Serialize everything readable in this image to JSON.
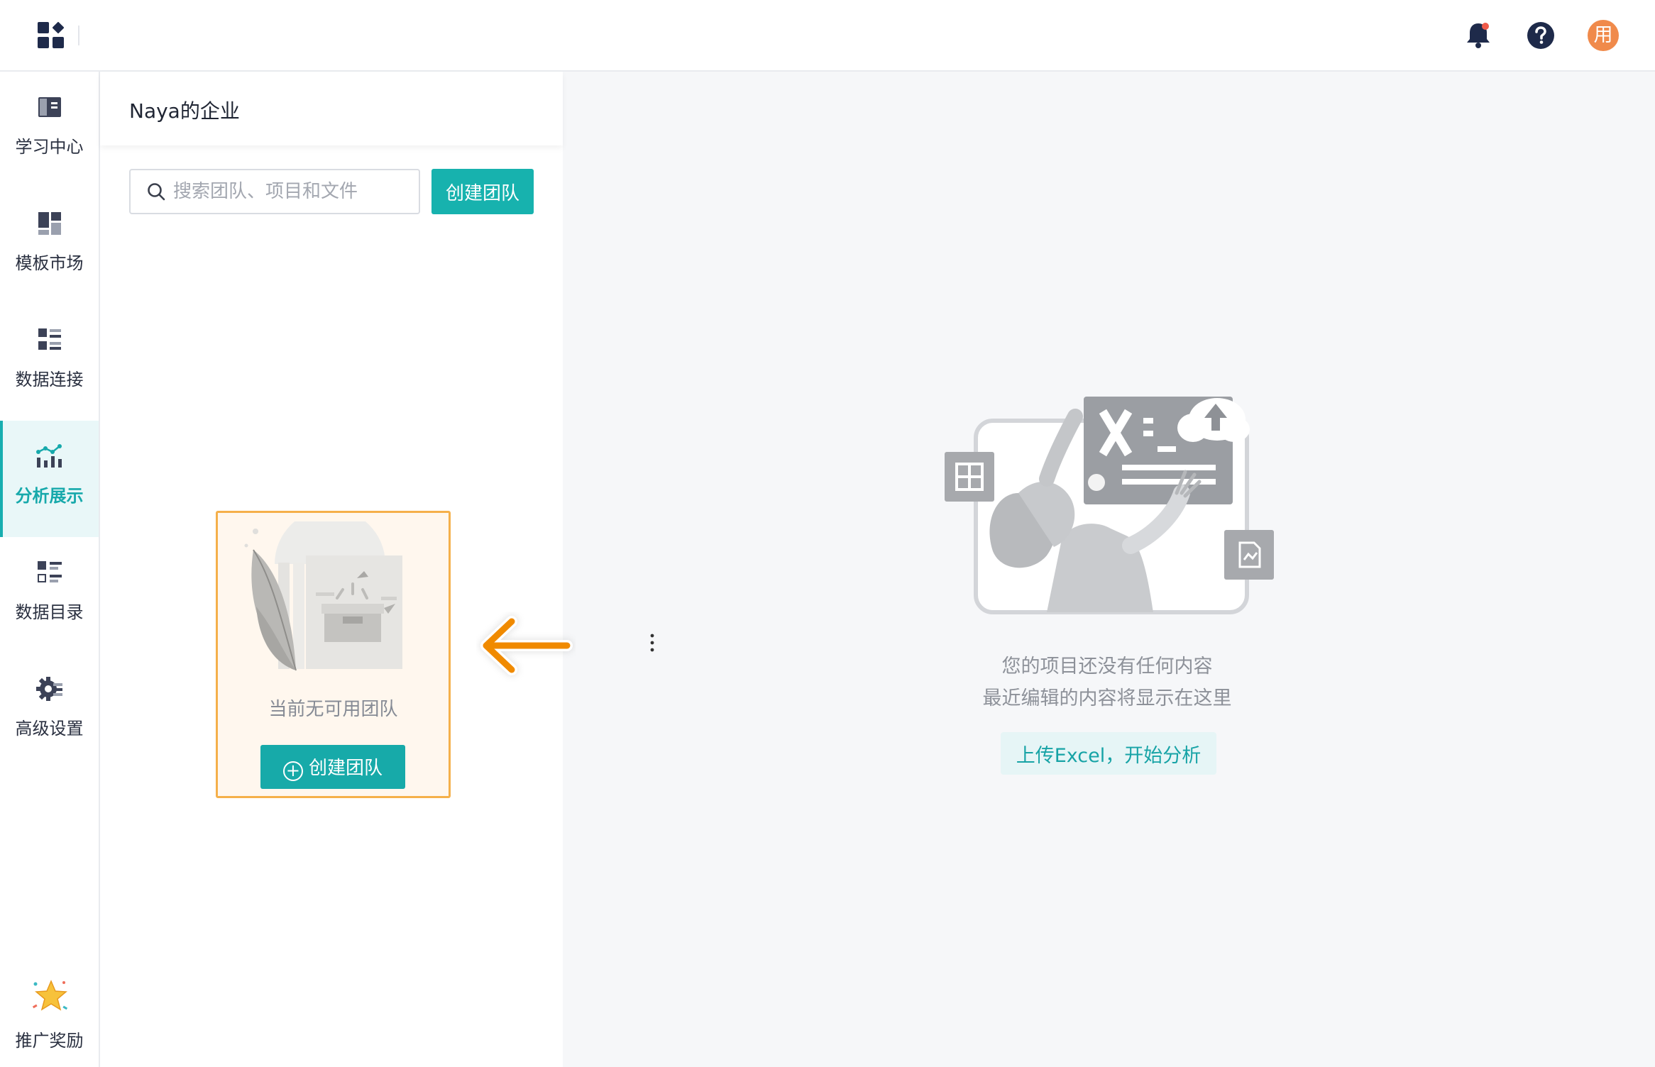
{
  "header": {
    "apps_icon": "apps-grid-icon",
    "notification_icon": "bell-icon",
    "help_icon": "help-icon",
    "avatar_text": "用"
  },
  "sidebar": {
    "items": [
      {
        "label": "学习中心",
        "icon": "book-icon",
        "active": false
      },
      {
        "label": "模板市场",
        "icon": "template-icon",
        "active": false
      },
      {
        "label": "数据连接",
        "icon": "data-connect-icon",
        "active": false
      },
      {
        "label": "分析展示",
        "icon": "chart-icon",
        "active": true
      },
      {
        "label": "数据目录",
        "icon": "catalog-icon",
        "active": false
      },
      {
        "label": "高级设置",
        "icon": "gear-icon",
        "active": false
      }
    ],
    "reward": {
      "label": "推广奖励",
      "icon": "star-icon"
    }
  },
  "team_panel": {
    "org_name": "Naya的企业",
    "search_placeholder": "搜索团队、项目和文件",
    "create_button": "创建团队",
    "empty_text": "当前无可用团队",
    "empty_create_button": "创建团队"
  },
  "main": {
    "message_line1": "您的项目还没有任何内容",
    "message_line2": "最近编辑的内容将显示在这里",
    "upload_button": "上传Excel，开始分析"
  },
  "colors": {
    "accent": "#17b2ae",
    "highlight_border": "#f5b04a",
    "arrow": "#f08a00",
    "avatar_bg": "#f08a4b"
  }
}
